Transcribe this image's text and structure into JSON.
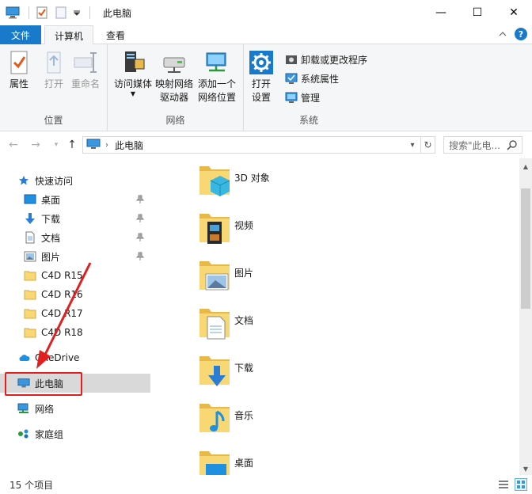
{
  "titlebar": {
    "title": "此电脑",
    "minimize": "—",
    "maximize": "☐",
    "close": "✕"
  },
  "tabs": {
    "file": "文件",
    "computer": "计算机",
    "view": "查看"
  },
  "ribbon": {
    "location": {
      "label": "位置",
      "properties": "属性",
      "open": "打开",
      "rename": "重命名"
    },
    "network": {
      "label": "网络",
      "access_media": "访问媒体",
      "map_drive_1": "映射网络",
      "map_drive_2": "驱动器",
      "add_location_1": "添加一个",
      "add_location_2": "网络位置"
    },
    "system": {
      "label": "系统",
      "open_settings_1": "打开",
      "open_settings_2": "设置",
      "uninstall": "卸载或更改程序",
      "system_props": "系统属性",
      "manage": "管理"
    }
  },
  "address": {
    "crumb": "此电脑",
    "search_placeholder": "搜索\"此电...",
    "refresh": "↻"
  },
  "navpane": {
    "quick_access": "快速访问",
    "items": [
      {
        "label": "桌面"
      },
      {
        "label": "下载"
      },
      {
        "label": "文档"
      },
      {
        "label": "图片"
      },
      {
        "label": "C4D R15"
      },
      {
        "label": "C4D R16"
      },
      {
        "label": "C4D R17"
      },
      {
        "label": "C4D R18"
      }
    ],
    "onedrive": "OneDrive",
    "this_pc": "此电脑",
    "network": "网络",
    "homegroup": "家庭组"
  },
  "content": {
    "folders": [
      {
        "name": "3D 对象"
      },
      {
        "name": "视频"
      },
      {
        "name": "图片"
      },
      {
        "name": "文档"
      },
      {
        "name": "下载"
      },
      {
        "name": "音乐"
      },
      {
        "name": "桌面"
      }
    ]
  },
  "status": {
    "count": "15 个项目"
  },
  "colors": {
    "accent": "#1979ca",
    "folder": "#f8d775",
    "folder_dark": "#e8b84a",
    "highlight_box": "#e02020"
  }
}
